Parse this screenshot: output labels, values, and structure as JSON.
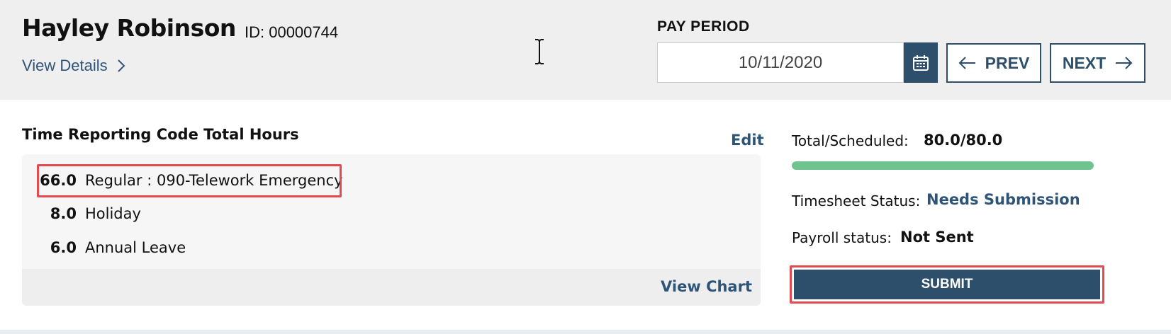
{
  "employee": {
    "name": "Hayley Robinson",
    "id_text": "ID: 00000744",
    "view_details_label": "View Details"
  },
  "pay_period": {
    "label": "PAY PERIOD",
    "date_value": "10/11/2020",
    "prev_label": "PREV",
    "next_label": "NEXT"
  },
  "trc": {
    "title": "Time Reporting Code Total Hours",
    "edit_label": "Edit",
    "rows": [
      {
        "hours": "66.0",
        "code": "Regular : 090-Telework Emergency"
      },
      {
        "hours": "8.0",
        "code": "Holiday"
      },
      {
        "hours": "6.0",
        "code": "Annual Leave"
      }
    ],
    "view_chart_label": "View Chart"
  },
  "summary": {
    "total_label": "Total/Scheduled:",
    "total_value": "80.0/80.0",
    "progress_fraction": 1.0,
    "timesheet_status_label": "Timesheet Status:",
    "timesheet_status_value": "Needs Submission",
    "payroll_status_label": "Payroll status:",
    "payroll_status_value": "Not Sent",
    "submit_label": "SUBMIT"
  },
  "colors": {
    "accent": "#2d4f6c",
    "link": "#2e5478",
    "progress": "#6fc38e",
    "highlight": "#e24a4f",
    "header_bg": "#efefef"
  },
  "icons": [
    "chevron-right-icon",
    "calendar-icon",
    "arrow-left-icon",
    "arrow-right-icon",
    "text-cursor-icon"
  ]
}
